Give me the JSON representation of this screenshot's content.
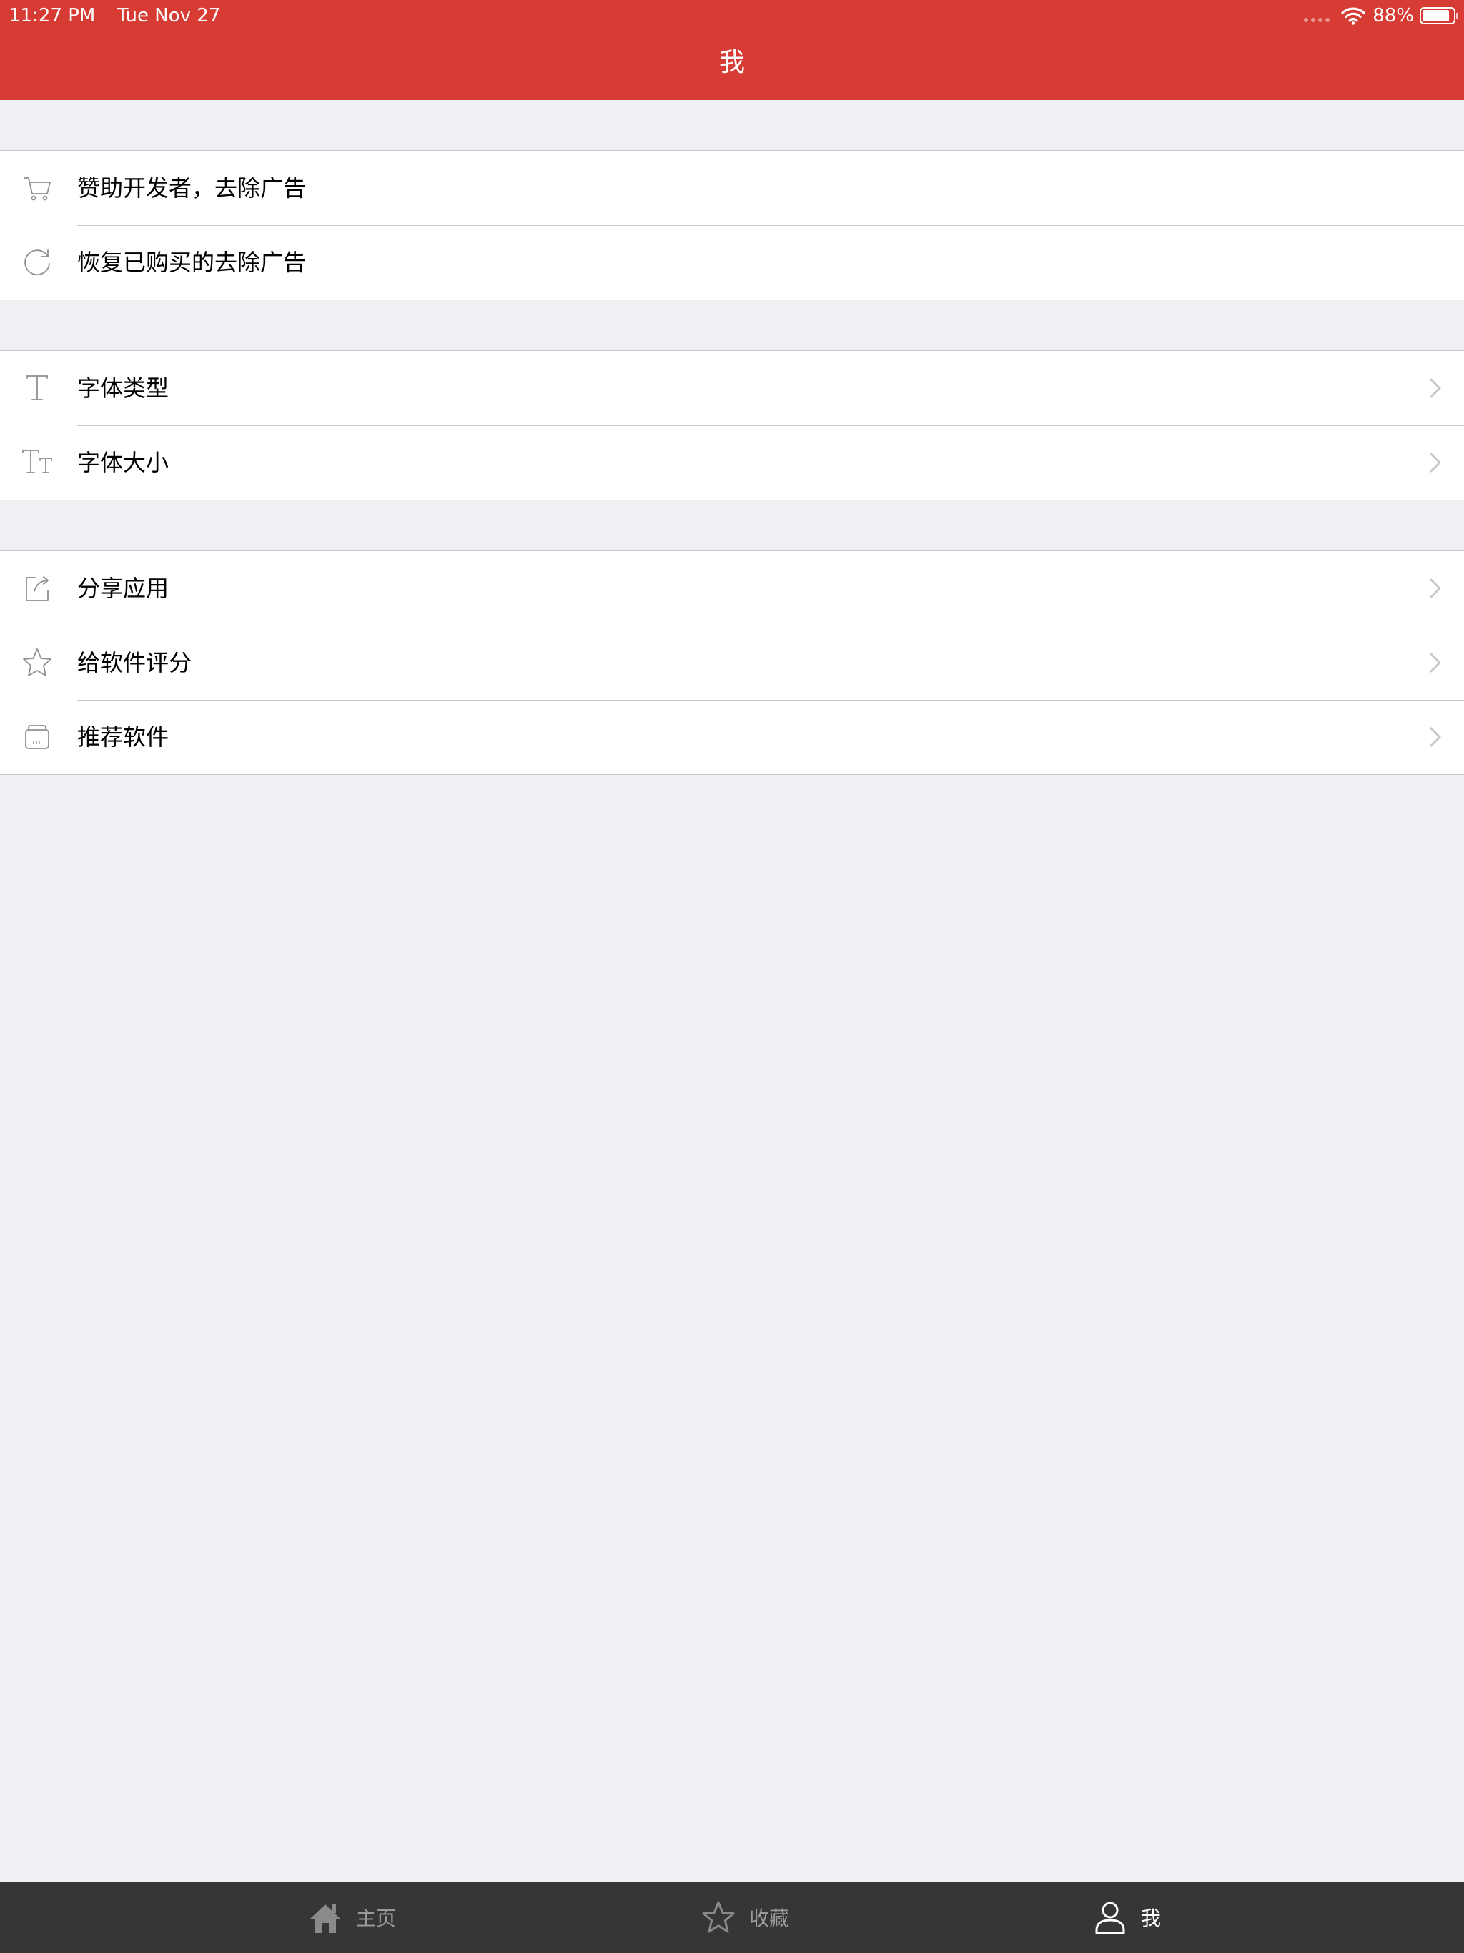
{
  "status_bar": {
    "time": "11:27 PM",
    "date": "Tue Nov 27",
    "battery": "88%",
    "battery_level": 0.88
  },
  "nav": {
    "title": "我"
  },
  "sections": [
    {
      "items": [
        {
          "label": "赞助开发者，去除广告",
          "icon": "cart-icon",
          "chevron": false
        },
        {
          "label": "恢复已购买的去除广告",
          "icon": "refresh-icon",
          "chevron": false
        }
      ]
    },
    {
      "items": [
        {
          "label": "字体类型",
          "icon": "font-type-icon",
          "chevron": true
        },
        {
          "label": "字体大小",
          "icon": "font-size-icon",
          "chevron": true
        }
      ]
    },
    {
      "items": [
        {
          "label": "分享应用",
          "icon": "share-icon",
          "chevron": true
        },
        {
          "label": "给软件评分",
          "icon": "star-icon",
          "chevron": true
        },
        {
          "label": "推荐软件",
          "icon": "app-store-icon",
          "chevron": true
        }
      ]
    }
  ],
  "tabbar": {
    "tabs": [
      {
        "label": "主页",
        "icon": "home-icon",
        "selected": false
      },
      {
        "label": "收藏",
        "icon": "star-icon",
        "selected": false
      },
      {
        "label": "我",
        "icon": "person-icon",
        "selected": true
      }
    ]
  },
  "colors": {
    "nav_background": "#d63b34",
    "page_background": "#efeff4",
    "tabbar_background": "#363636",
    "tab_inactive": "#9a9a9a",
    "tab_active": "#ffffff",
    "row_icon": "#8e8e93"
  }
}
